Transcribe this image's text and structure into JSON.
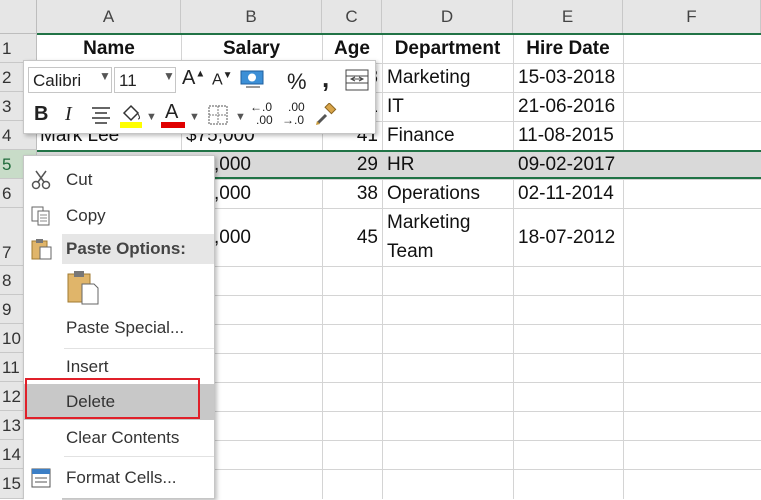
{
  "sheet": {
    "columns": [
      "A",
      "B",
      "C",
      "D",
      "E",
      "F"
    ],
    "rows": [
      "1",
      "2",
      "3",
      "4",
      "5",
      "6",
      "7",
      "8",
      "9",
      "10",
      "11",
      "12",
      "13",
      "14",
      "15"
    ],
    "headers": {
      "name": "Name",
      "salary": "Salary",
      "age": "Age",
      "department": "Department",
      "hire_date": "Hire Date"
    },
    "data": [
      {
        "name": "",
        "salary": "",
        "age": "",
        "department": "Marketing",
        "hire_date": "15-03-2018"
      },
      {
        "name": "",
        "salary": "",
        "age": "",
        "department": "IT",
        "hire_date": "21-06-2016"
      },
      {
        "name": "Mark Lee",
        "salary": "$75,000",
        "age": "41",
        "department": "Finance",
        "hire_date": "11-08-2015"
      },
      {
        "name": "",
        "salary": ",000",
        "age": "29",
        "department": "HR",
        "hire_date": "09-02-2017"
      },
      {
        "name": "",
        "salary": ",000",
        "age": "38",
        "department": "Operations",
        "hire_date": "02-11-2014"
      },
      {
        "name": "",
        "salary": ",000",
        "age": "45",
        "department_line1": "Marketing",
        "department_line2": "Team",
        "hire_date": "18-07-2012"
      }
    ],
    "partial_age_row2": "8",
    "partial_age_row3": "1"
  },
  "mini_toolbar": {
    "font_name": "Calibri",
    "font_size": "11",
    "percent": "%",
    "comma": ",",
    "bold": "B",
    "italic": "I",
    "increase_decimal": ".00",
    "decrease_decimal": ".00",
    "colors": {
      "highlight": "#ffff00",
      "font": "#e00000"
    }
  },
  "context_menu": {
    "cut": "Cut",
    "copy": "Copy",
    "paste_options": "Paste Options:",
    "paste_special": "Paste Special...",
    "insert": "Insert",
    "delete": "Delete",
    "clear_contents": "Clear Contents",
    "format_cells": "Format Cells...",
    "colors": {
      "highlight_border": "#e0202a",
      "hover_bg": "#c8c8c8"
    }
  }
}
